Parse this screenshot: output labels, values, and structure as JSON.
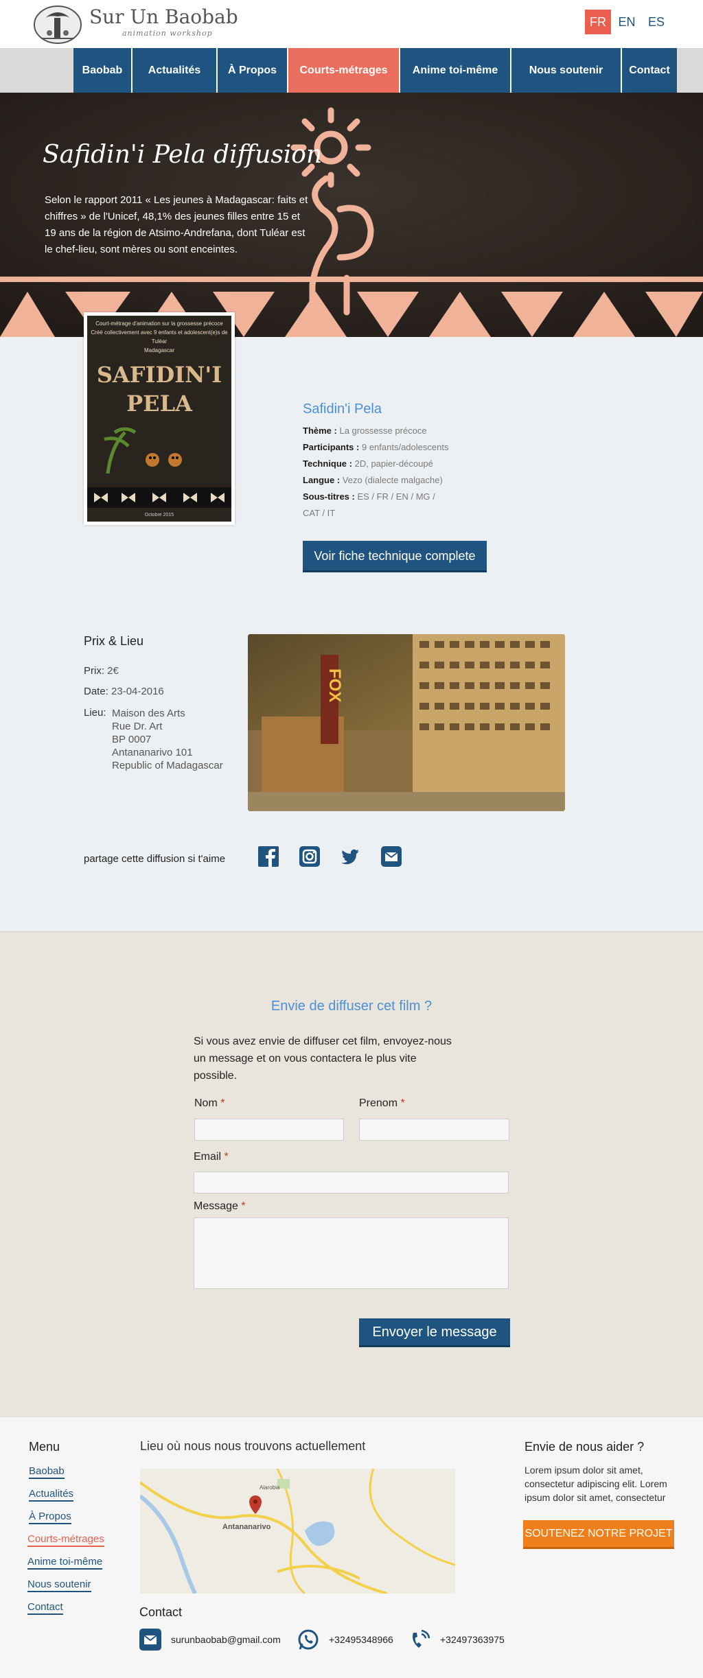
{
  "brand": {
    "name": "Sur Un Baobab",
    "tagline": "animation workshop"
  },
  "languages": [
    {
      "label": "FR",
      "active": true
    },
    {
      "label": "EN",
      "active": false
    },
    {
      "label": "ES",
      "active": false
    }
  ],
  "nav": [
    "Baobab",
    "Actualités",
    "À Propos",
    "Courts-métrages",
    "Anime toi-même",
    "Nous soutenir",
    "Contact"
  ],
  "nav_active": "Courts-métrages",
  "hero": {
    "title": "Safidin'i Pela diffusion",
    "text": "Selon le rapport 2011 « Les jeunes à Madagascar: faits et chiffres » de l'Unicef, 48,1% des jeunes filles entre 15 et 19 ans de la région de Atsimo-Andrefana, dont Tuléar est le chef-lieu, sont mères ou sont enceintes."
  },
  "poster": {
    "caption_lines": [
      "Court-métrage d'animation sur la grossesse précoce",
      "Créé collectivement avec 9 enfants et adolescent(e)s de Tuléar",
      "Madagascar"
    ],
    "title_lines": [
      "SAFIDIN'I",
      "PELA"
    ],
    "footer_date": "Octobre 2015"
  },
  "film": {
    "title": "Safidin'i Pela",
    "specs": [
      {
        "label": "Thème :",
        "value": "La grossesse précoce"
      },
      {
        "label": "Participants :",
        "value": "9 enfants/adolescents"
      },
      {
        "label": "Technique :",
        "value": "2D, papier-découpé"
      },
      {
        "label": "Langue :",
        "value": "Vezo (dialecte malgache)"
      },
      {
        "label": "Sous-titres :",
        "value": "ES / FR / EN / MG /"
      }
    ],
    "specs_cont": "CAT / IT",
    "tech_button": "Voir fiche technique complete"
  },
  "event": {
    "heading": "Prix & Lieu",
    "price_label": "Prix:",
    "price": "2€",
    "date_label": "Date:",
    "date": "23-04-2016",
    "place_label": "Lieu:",
    "place_lines": [
      "Maison des Arts",
      "Rue Dr. Art",
      "BP 0007",
      "Antananarivo 101",
      "Republic of Madagascar"
    ],
    "photo_sign": "FOX"
  },
  "share": {
    "text": "partage cette diffusion si t'aime",
    "icons": [
      "facebook-icon",
      "instagram-icon",
      "twitter-icon",
      "email-icon"
    ]
  },
  "contact_form": {
    "title": "Envie de diffuser cet film ?",
    "text": "Si vous avez envie de diffuser cet film, envoyez-nous un message et on vous contactera le plus vite possible.",
    "nom_label": "Nom",
    "prenom_label": "Prenom",
    "email_label": "Email",
    "message_label": "Message",
    "required_mark": "*",
    "send_button": "Envoyer le message"
  },
  "footer": {
    "menu_title": "Menu",
    "menu": [
      "Baobab",
      "Actualités",
      "À Propos",
      "Courts-métrages",
      "Anime toi-même",
      "Nous soutenir",
      "Contact"
    ],
    "location_title": "Lieu où nous nous trouvons actuellement",
    "map_labels": {
      "city": "Antananarivo",
      "place": "Alarobia"
    },
    "contact_title": "Contact",
    "email": "surunbaobab@gmail.com",
    "whatsapp": "+32495348966",
    "phone": "+32497363975",
    "help_title": "Envie de nous aider ?",
    "help_text": "Lorem ipsum dolor sit amet, consectetur adipiscing elit. Lorem ipsum dolor sit amet, consectetur",
    "help_button": "SOUTENEZ NOTRE PROJET"
  },
  "colors": {
    "primary": "#1f5480",
    "accent": "#ea5f4e",
    "link": "#4a90d9",
    "orange": "#ef7f1a"
  }
}
